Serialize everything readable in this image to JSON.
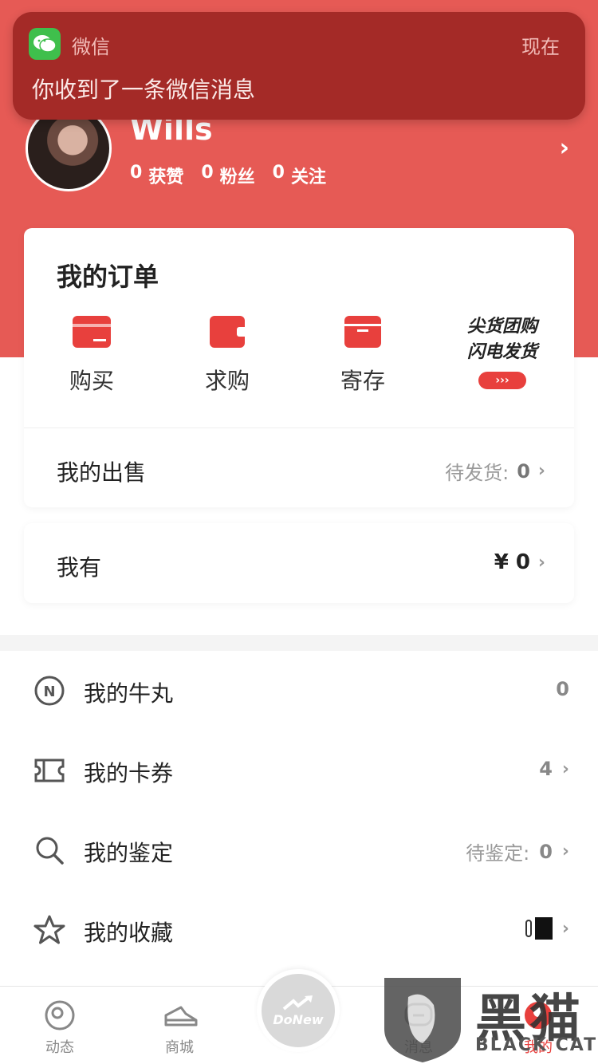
{
  "notification": {
    "app_name": "微信",
    "time": "现在",
    "message": "你收到了一条微信消息"
  },
  "profile": {
    "username": "Wills",
    "stats": [
      {
        "value": "0",
        "label": "获赞"
      },
      {
        "value": "0",
        "label": "粉丝"
      },
      {
        "value": "0",
        "label": "关注"
      }
    ]
  },
  "orders": {
    "title": "我的订单",
    "items": [
      {
        "label": "购买",
        "icon": "card-icon"
      },
      {
        "label": "求购",
        "icon": "wallet-icon"
      },
      {
        "label": "寄存",
        "icon": "box-icon"
      }
    ],
    "promo": {
      "line1": "尖货团购",
      "line2": "闪电发货",
      "pill": "›››"
    }
  },
  "sales": {
    "label": "我的出售",
    "status_label": "待发货:",
    "count": "0"
  },
  "wallet": {
    "label": "我有",
    "amount": "¥ 0"
  },
  "menu": [
    {
      "label": "我的牛丸",
      "icon": "n-coin-icon",
      "right_label": "",
      "value": "0",
      "chevron": false
    },
    {
      "label": "我的卡券",
      "icon": "ticket-icon",
      "right_label": "",
      "value": "4",
      "chevron": true
    },
    {
      "label": "我的鉴定",
      "icon": "search-icon",
      "right_label": "待鉴定:",
      "value": "0",
      "chevron": true
    },
    {
      "label": "我的收藏",
      "icon": "star-icon",
      "right_label": "",
      "value": "",
      "chevron": true
    }
  ],
  "tabbar": {
    "tabs": [
      {
        "label": "动态",
        "icon": "dynamic-icon"
      },
      {
        "label": "商城",
        "icon": "shoe-icon"
      },
      {
        "label": "",
        "icon": "donew-icon",
        "center_text": "DoNew"
      },
      {
        "label": "消息",
        "icon": "message-icon"
      },
      {
        "label": "我的",
        "icon": "profile-icon"
      }
    ]
  },
  "watermark": {
    "big_text": "黑猫",
    "small_text": "BLACK CAT"
  },
  "colors": {
    "brand_red": "#e65a55",
    "accent_red": "#e8403d",
    "notif_bg": "#a42a27",
    "wechat_green": "#3fbf4c"
  }
}
